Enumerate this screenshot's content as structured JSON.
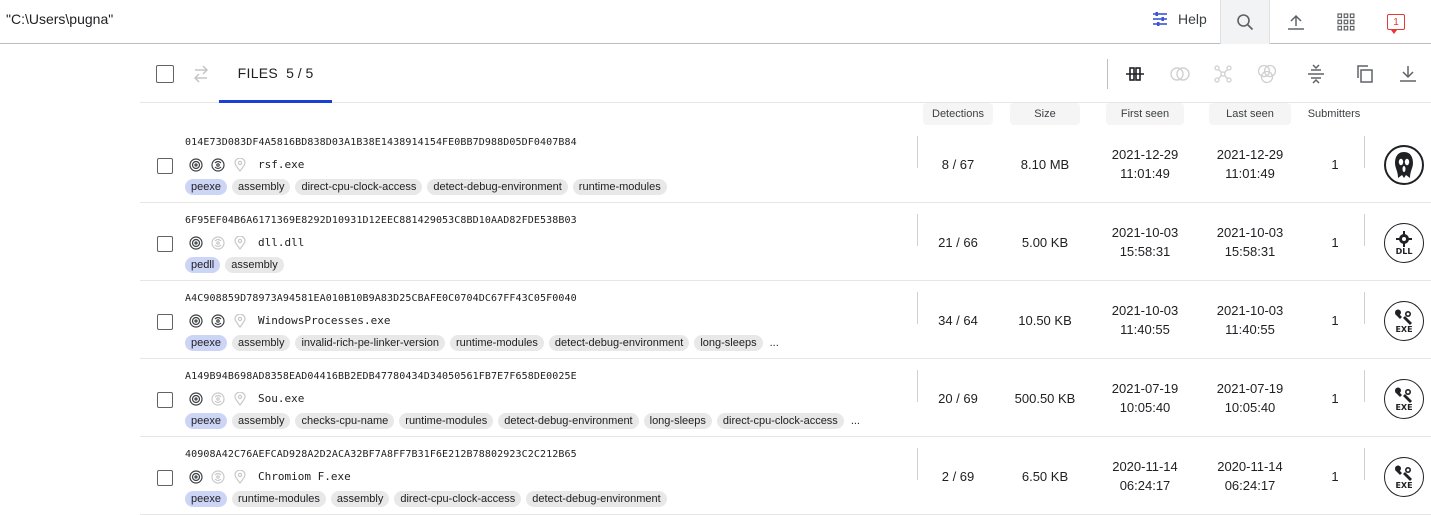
{
  "topbar": {
    "query": "\"C:\\Users\\pugna\"",
    "help_label": "Help",
    "notification_count": "1"
  },
  "toolbar": {
    "files_label": "FILES",
    "files_count": "5 / 5"
  },
  "columns": {
    "detections": "Detections",
    "size": "Size",
    "first_seen": "First seen",
    "last_seen": "Last seen",
    "submitters": "Submitters"
  },
  "rows": [
    {
      "hash": "014E73D083DF4A5816BD838D03A1B38E1438914154FE0BB7D988D05DF0407B84",
      "name": "rsf.exe",
      "tags": [
        "peexe",
        "assembly",
        "direct-cpu-clock-access",
        "detect-debug-environment",
        "runtime-modules"
      ],
      "more": "",
      "detections": "8 / 67",
      "size": "8.10 MB",
      "first_date": "2021-12-29",
      "first_time": "11:01:49",
      "last_date": "2021-12-29",
      "last_time": "11:01:49",
      "submitters": "1",
      "file_type_icon": "ghost-icon",
      "file_type_label": "",
      "sandbox_active": true
    },
    {
      "hash": "6F95EF04B6A6171369E8292D10931D12EEC881429053C8BD10AAD82FDE538B03",
      "name": "dll.dll",
      "tags": [
        "pedll",
        "assembly"
      ],
      "more": "",
      "detections": "21 / 66",
      "size": "5.00 KB",
      "first_date": "2021-10-03",
      "first_time": "15:58:31",
      "last_date": "2021-10-03",
      "last_time": "15:58:31",
      "submitters": "1",
      "file_type_icon": "gear-icon",
      "file_type_label": "DLL",
      "sandbox_active": false
    },
    {
      "hash": "A4C908859D78973A94581EA010B10B9A83D25CBAFE0C0704DC67FF43C05F0040",
      "name": "WindowsProcesses.exe",
      "tags": [
        "peexe",
        "assembly",
        "invalid-rich-pe-linker-version",
        "runtime-modules",
        "detect-debug-environment",
        "long-sleeps"
      ],
      "more": "...",
      "detections": "34 / 64",
      "size": "10.50 KB",
      "first_date": "2021-10-03",
      "first_time": "11:40:55",
      "last_date": "2021-10-03",
      "last_time": "11:40:55",
      "submitters": "1",
      "file_type_icon": "wrench-icon",
      "file_type_label": "EXE",
      "sandbox_active": true
    },
    {
      "hash": "A149B94B698AD8358EAD04416BB2EDB47780434D34050561FB7E7F658DE0025E",
      "name": "Sou.exe",
      "tags": [
        "peexe",
        "assembly",
        "checks-cpu-name",
        "runtime-modules",
        "detect-debug-environment",
        "long-sleeps",
        "direct-cpu-clock-access"
      ],
      "more": "...",
      "detections": "20 / 69",
      "size": "500.50 KB",
      "first_date": "2021-07-19",
      "first_time": "10:05:40",
      "last_date": "2021-07-19",
      "last_time": "10:05:40",
      "submitters": "1",
      "file_type_icon": "wrench-icon",
      "file_type_label": "EXE",
      "sandbox_active": false
    },
    {
      "hash": "40908A42C76AEFCAD928A2D2ACA32BF7A8FF7B31F6E212B78802923C2C212B65",
      "name": "Chromiom F.exe",
      "tags": [
        "peexe",
        "runtime-modules",
        "assembly",
        "direct-cpu-clock-access",
        "detect-debug-environment"
      ],
      "more": "",
      "detections": "2 / 69",
      "size": "6.50 KB",
      "first_date": "2020-11-14",
      "first_time": "06:24:17",
      "last_date": "2020-11-14",
      "last_time": "06:24:17",
      "submitters": "1",
      "file_type_icon": "wrench-icon",
      "file_type_label": "EXE",
      "sandbox_active": false
    }
  ],
  "colors": {
    "accent": "#1a3fd6",
    "highlight_tag": "#cdd5f7",
    "tag": "#e8e8e8",
    "notification": "#e53935"
  }
}
